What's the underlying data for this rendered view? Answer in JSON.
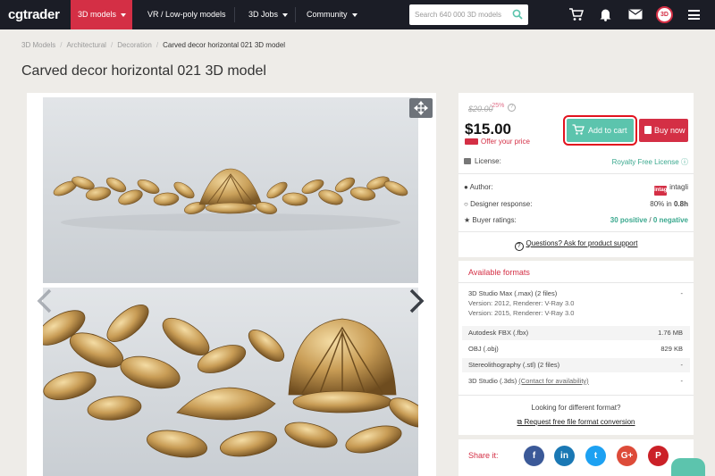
{
  "nav": {
    "logo": "cgtrader",
    "models": "3D models",
    "lowpoly": "VR / Low-poly models",
    "jobs": "3D Jobs",
    "community": "Community",
    "search_placeholder": "Search 640 000 3D models",
    "avatar": "3D",
    "icons": [
      "cart-icon",
      "bell-icon",
      "mail-icon",
      "avatar",
      "menu-icon"
    ]
  },
  "breadcrumb": [
    "3D Models",
    "Architectural",
    "Decoration",
    "Carved decor horizontal 021 3D model"
  ],
  "title": "Carved decor horizontal 021 3D model",
  "pricing": {
    "old_price": "$20.00",
    "discount": "-25%",
    "help": "?",
    "price": "$15.00",
    "offer": "Offer your price",
    "add_to_cart": "Add to cart",
    "buy_now": "Buy now"
  },
  "license": {
    "label": "License:",
    "value": "Royalty Free License"
  },
  "author": {
    "label": "Author:",
    "logo_text": "intagli",
    "name": "intagli",
    "response_label": "Designer response:",
    "response_rate": "80%",
    "response_in": "in",
    "response_time": "0.8h",
    "ratings_label": "Buyer ratings:",
    "positive": "30 positive",
    "slash": "/",
    "negative": "0 negative",
    "support": "Questions? Ask for product support"
  },
  "formats": {
    "title": "Available formats",
    "items": [
      {
        "name": "3D Studio Max (.max) (2 files)",
        "size": "-",
        "sub1": "Version: 2012, Renderer: V-Ray 3.0",
        "sub2": "Version: 2015, Renderer: V-Ray 3.0"
      },
      {
        "name": "Autodesk FBX (.fbx)",
        "size": "1.76 MB"
      },
      {
        "name": "OBJ (.obj)",
        "size": "829 KB"
      },
      {
        "name": "Stereolithography (.stl) (2 files)",
        "size": "-"
      },
      {
        "name": "3D Studio (.3ds)",
        "link": "(Contact for availability)",
        "size": "-"
      }
    ],
    "looking": "Looking for different format?",
    "request": "Request free file format conversion"
  },
  "share": {
    "label": "Share it:",
    "networks": [
      {
        "glyph": "f",
        "color": "#3b5998"
      },
      {
        "glyph": "in",
        "color": "#1a78b4"
      },
      {
        "glyph": "t",
        "color": "#1da1f2"
      },
      {
        "glyph": "G+",
        "color": "#dd4b39"
      },
      {
        "glyph": "P",
        "color": "#cb2027"
      }
    ]
  },
  "colors": {
    "nav_bg": "#1b1d26",
    "accent": "#d42f45",
    "cart": "#5cc4ad",
    "link_green": "#3aa88e"
  }
}
